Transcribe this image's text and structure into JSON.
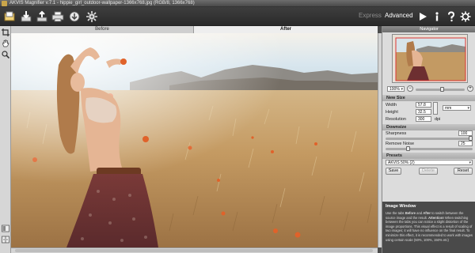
{
  "app": {
    "title": "AKVIS Magnifier v.7.1 - hippie_girl_outdoor-wallpaper-1366x768.jpg (RGB/8, 1366x768)"
  },
  "toolbar": {
    "icons": [
      "open-icon",
      "save-icon",
      "batch-icon",
      "print-icon",
      "share-icon",
      "settings-gear-icon"
    ],
    "express_label": "Express",
    "advanced_label": "Advanced",
    "right_icons": [
      "run-icon",
      "info-icon",
      "help-icon",
      "preferences-icon"
    ]
  },
  "tabs": {
    "before_label": "Before",
    "after_label": "After",
    "active": "After"
  },
  "navigator": {
    "title": "Navigator",
    "zoom_value": "100%",
    "zoom_level": 0.55
  },
  "new_size": {
    "title": "New Size",
    "width_label": "Width",
    "width_value": "57.8",
    "height_label": "Height",
    "height_value": "32.5",
    "unit_value": "mm",
    "resolution_label": "Resolution",
    "resolution_value": "300",
    "resolution_unit": "dpi"
  },
  "downsize": {
    "title": "Downsize",
    "sharpness_label": "Sharpness",
    "sharpness_value": "100",
    "sharpness_level": 1.0,
    "remove_noise_label": "Remove Noise",
    "remove_noise_value": "25",
    "remove_noise_level": 0.25
  },
  "presets": {
    "title": "Presets",
    "selected": "AKVIS 50% (2)",
    "save_label": "Save",
    "delete_label": "Delete",
    "reset_label": "Reset"
  },
  "image_window": {
    "title": "Image Window",
    "text_part1": "Use the tabs ",
    "text_before": "Before",
    "text_and": " and ",
    "text_after": "After",
    "text_part2": " to switch between the source image and the result. ",
    "text_attention": "Attention!",
    "text_part3": " When switching between the tabs you can notice a slight distortion of the image proportions. This visual effect is a result of scaling of two images; it will have no influence on the final result. To minimize this effect, it is recommended to work with images using certain scale (50%, 100%, 150% etc)"
  },
  "colors": {
    "toolbar_bg": "#2e2e2e",
    "panel_bg": "#dcdcdc",
    "section_header": "#b4b4b4",
    "info_bg": "#4a4a4a",
    "sky": "#cfe0ea",
    "field": "#c9a16a"
  }
}
